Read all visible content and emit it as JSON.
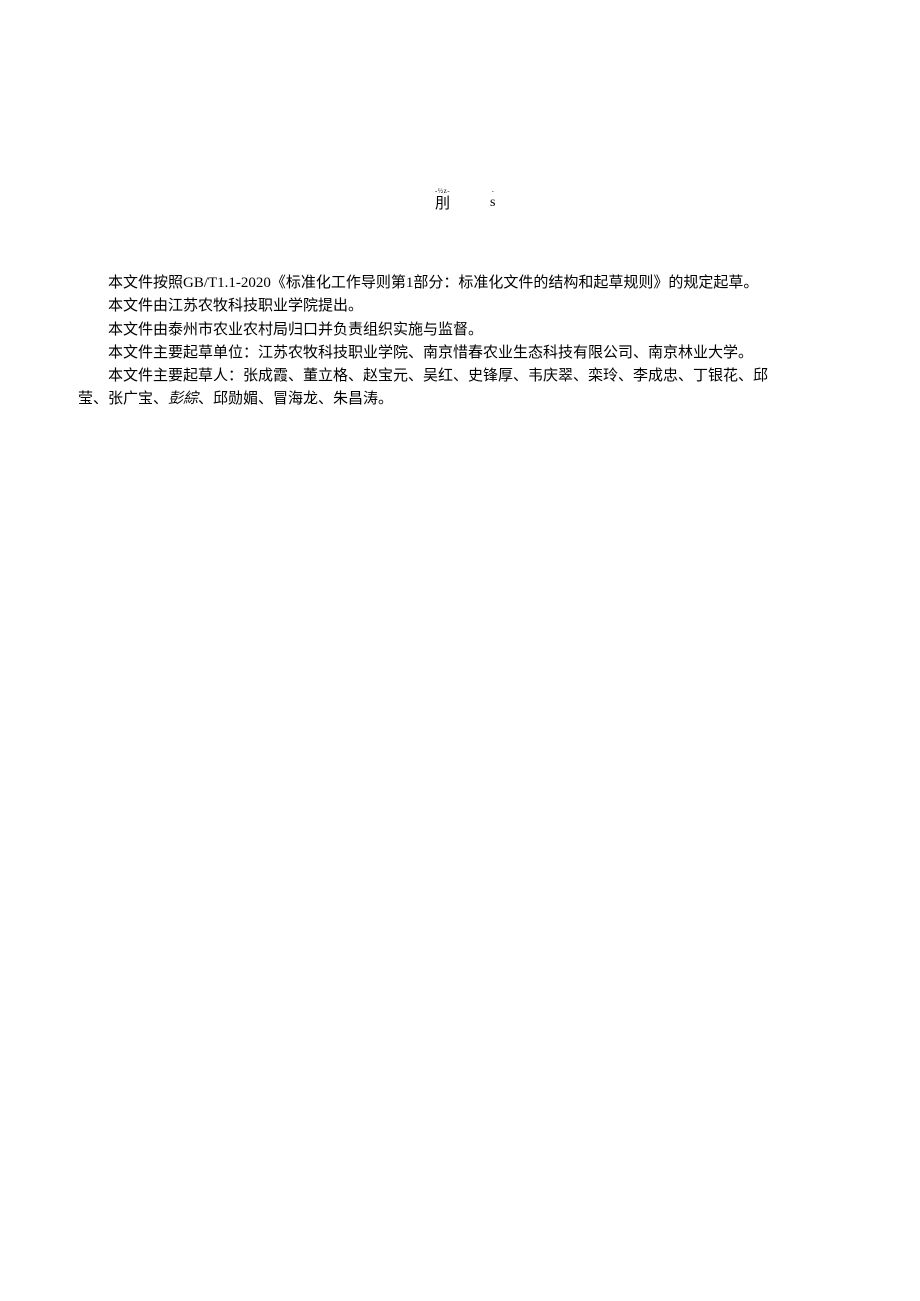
{
  "header": {
    "mark1_top": "-½z-",
    "mark1_bottom": "刖",
    "mark2_top": "-",
    "mark2_bottom": "s"
  },
  "content": {
    "line1": "本文件按照GB/T1.1-2020《标准化工作导则第1部分：标准化文件的结构和起草规则》的规定起草。",
    "line2": "本文件由江苏农牧科技职业学院提出。",
    "line3": "本文件由泰州市农业农村局归口并负责组织实施与监督。",
    "line4": "本文件主要起草单位：江苏农牧科技职业学院、南京惜春农业生态科技有限公司、南京林业大学。",
    "line5_part1": "本文件主要起草人：张成霞、董立格、赵宝元、吴红、史锋厚、韦庆翠、栾玲、李成忠、丁银花、邱",
    "line5_part2_before_italic": "莹、张广宝、",
    "line5_part2_italic": "彭綜",
    "line5_part2_after_italic": "、邱勋媚、冒海龙、朱昌涛。"
  }
}
